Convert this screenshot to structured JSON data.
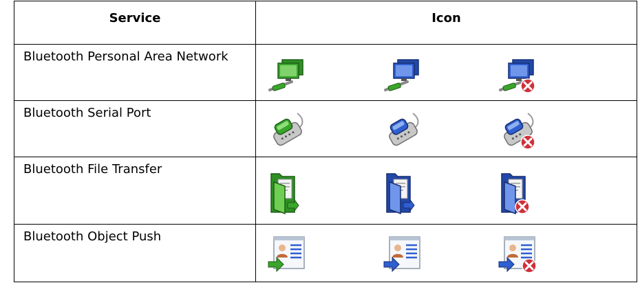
{
  "table": {
    "headers": {
      "service": "Service",
      "icon": "Icon"
    },
    "rows": [
      {
        "name": "Bluetooth Personal Area Network",
        "icons": [
          "network-connected-icon",
          "network-disconnected-icon",
          "network-error-icon"
        ]
      },
      {
        "name": "Bluetooth Serial Port",
        "icons": [
          "serial-port-connected-icon",
          "serial-port-disconnected-icon",
          "serial-port-error-icon"
        ]
      },
      {
        "name": "Bluetooth File Transfer",
        "icons": [
          "file-transfer-connected-icon",
          "file-transfer-disconnected-icon",
          "file-transfer-error-icon"
        ]
      },
      {
        "name": "Bluetooth Object Push",
        "icons": [
          "object-push-connected-icon",
          "object-push-disconnected-icon",
          "object-push-error-icon"
        ]
      }
    ]
  },
  "colors": {
    "connected": "#3aa52b",
    "disconnected": "#2f5fd0",
    "error": "#d0303a"
  }
}
